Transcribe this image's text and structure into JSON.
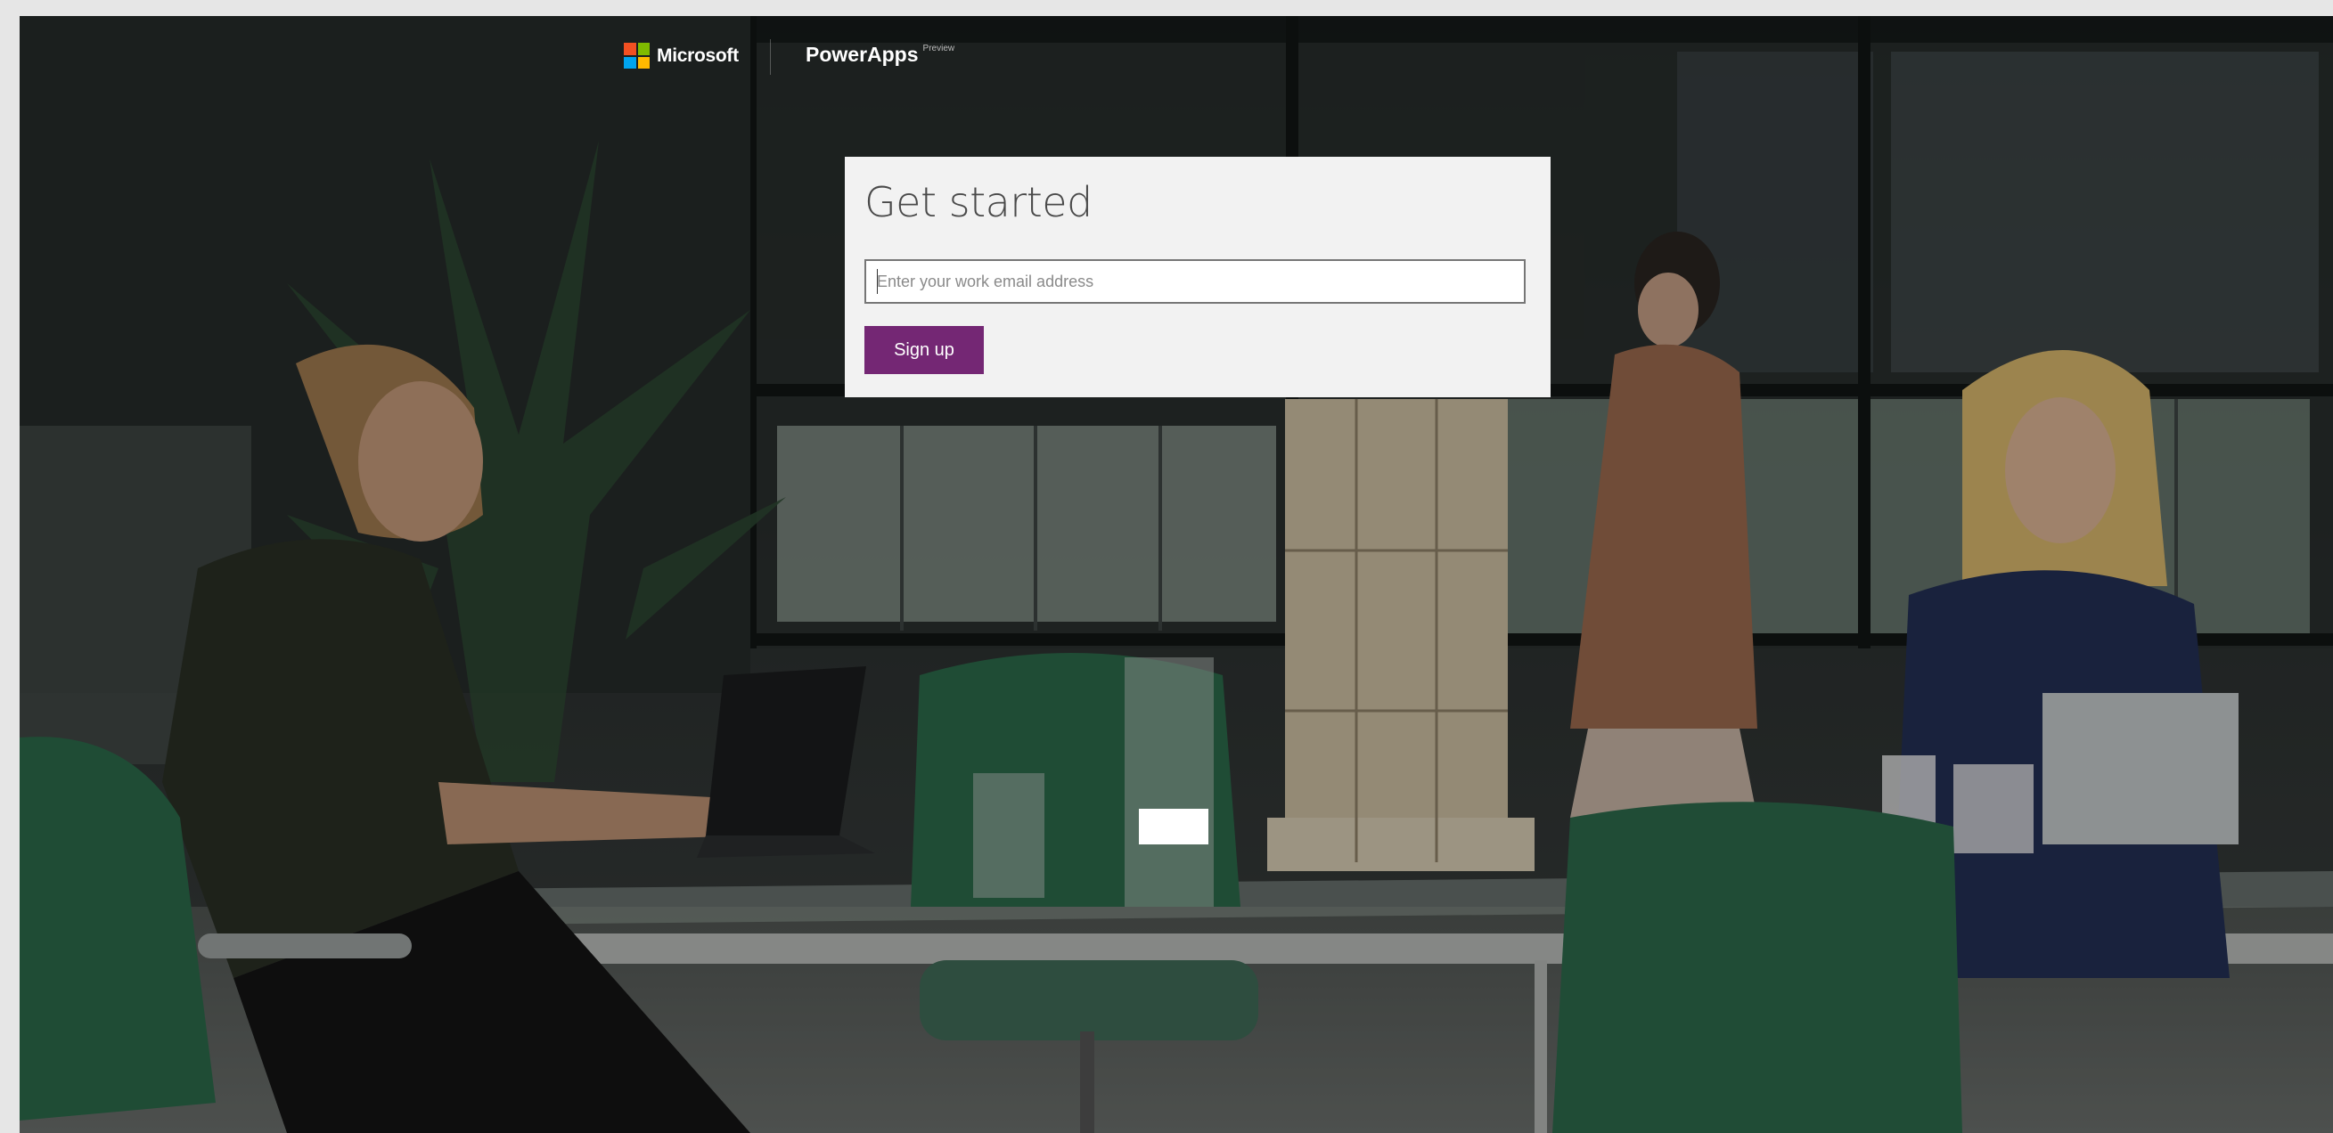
{
  "header": {
    "brand": "Microsoft",
    "product": "PowerApps",
    "product_tag": "Preview"
  },
  "signup": {
    "title": "Get started",
    "email_placeholder": "Enter your work email address",
    "email_value": "",
    "button_label": "Sign up"
  },
  "colors": {
    "accent": "#742774",
    "card": "#f2f2f2",
    "logo_red": "#f25022",
    "logo_green": "#7fba00",
    "logo_blue": "#00a4ef",
    "logo_yellow": "#ffb900"
  }
}
